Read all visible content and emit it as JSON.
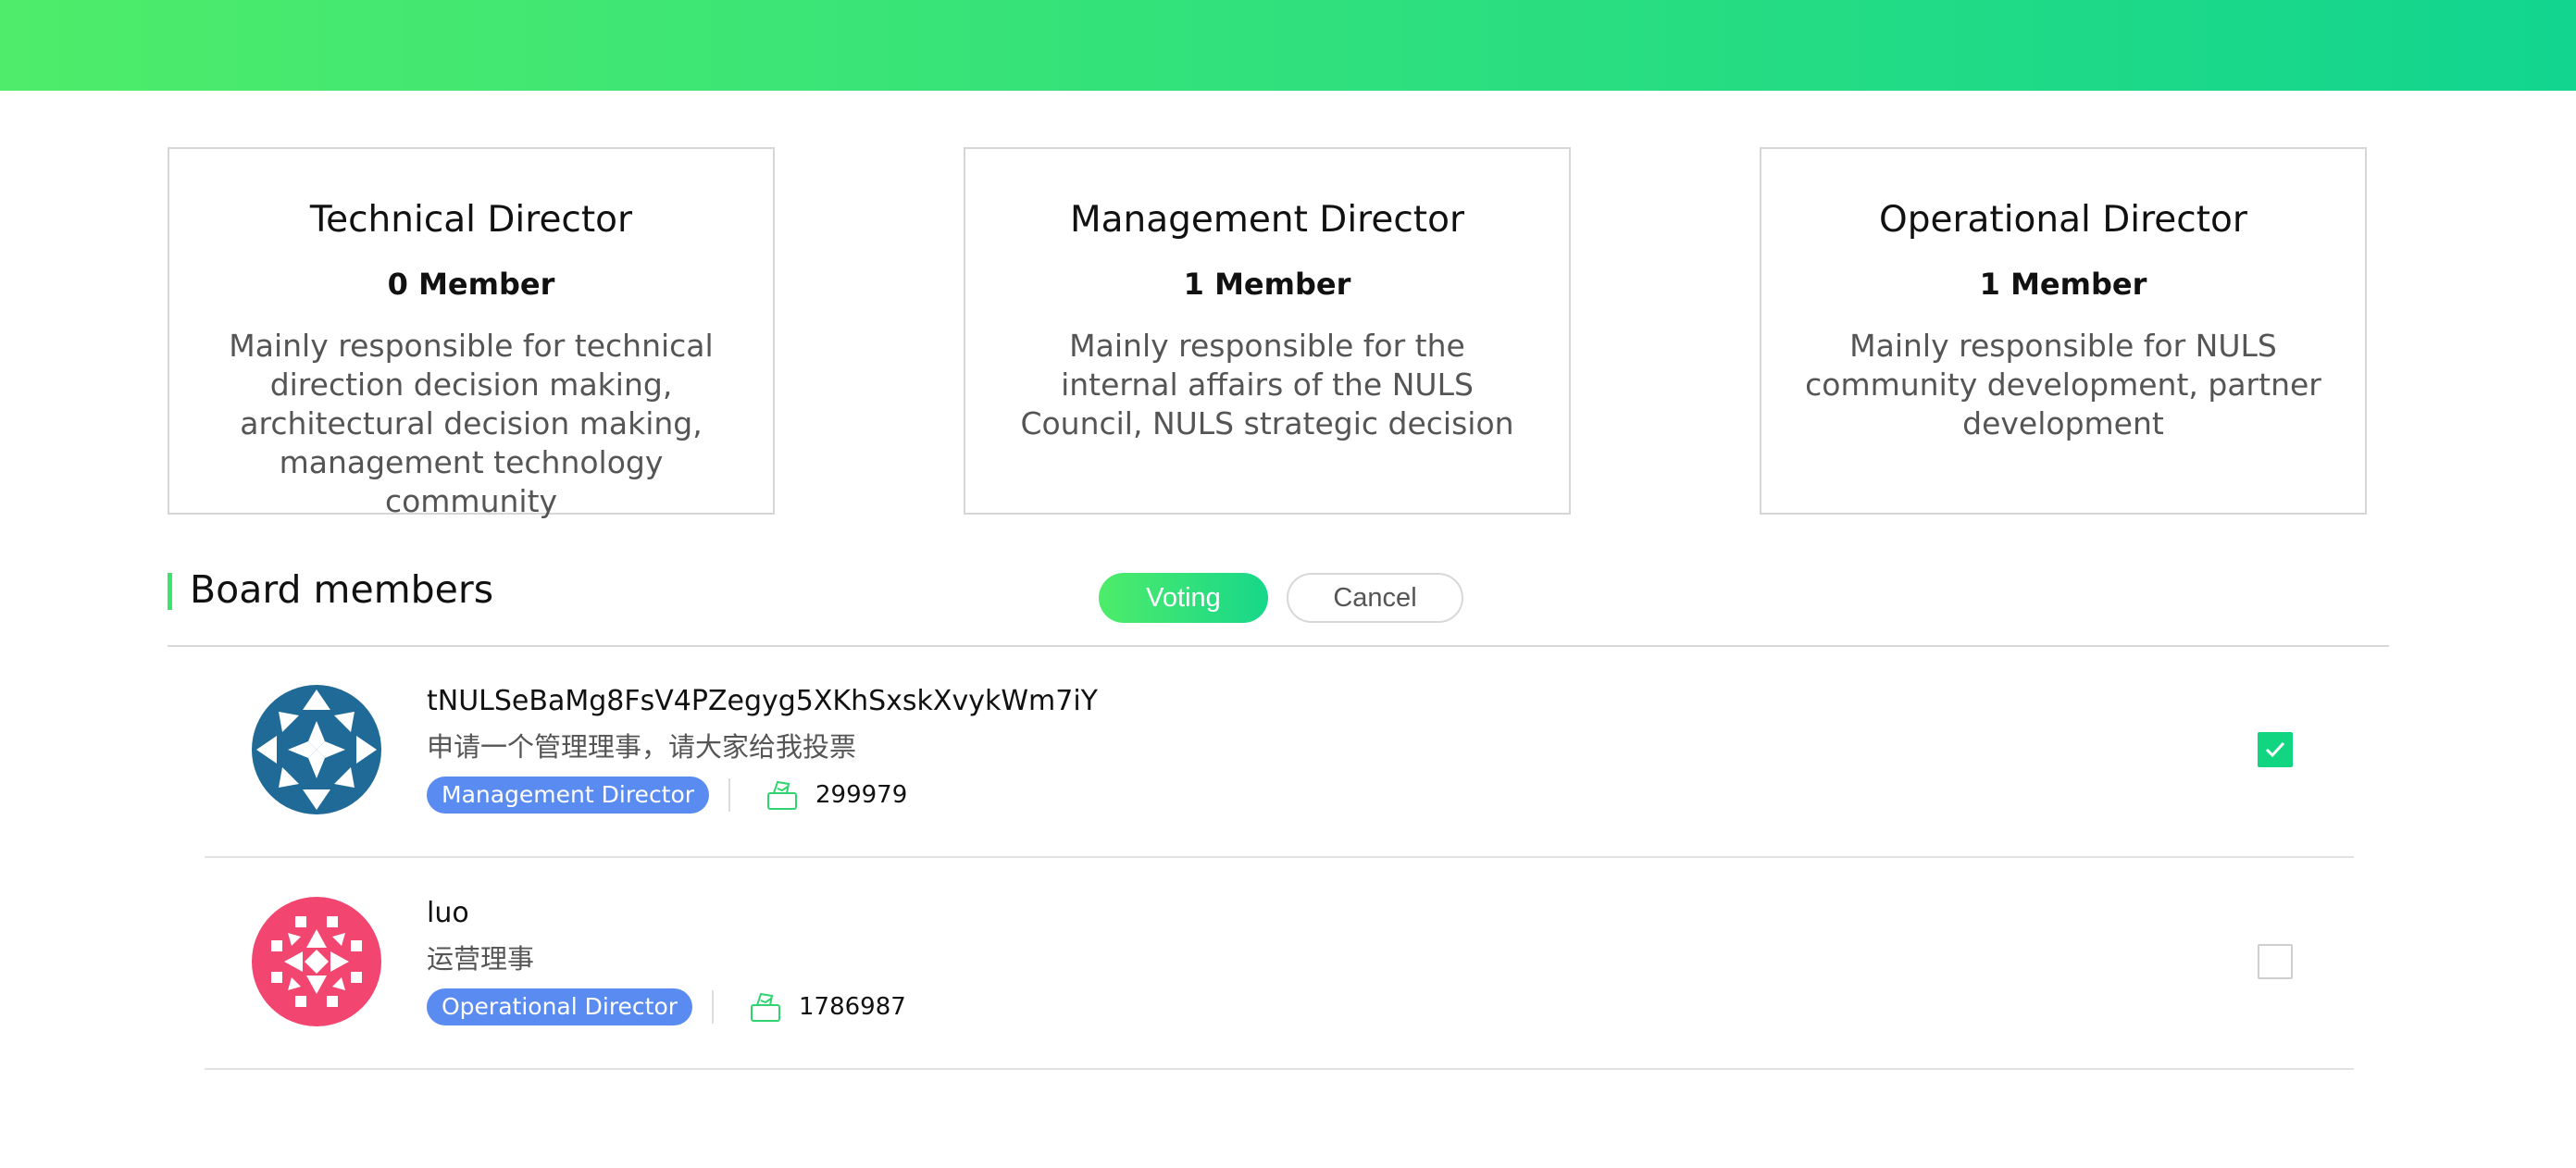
{
  "colors": {
    "accent_green": "#3ee26f",
    "banner_start": "#4eec6a",
    "banner_end": "#12d58f",
    "tag_blue": "#5a8bf0",
    "avatar1": "#1f6a97",
    "avatar2": "#f2456f",
    "checkbox_checked": "#12d581"
  },
  "roles": [
    {
      "title": "Technical Director",
      "count": "0 Member",
      "description": "Mainly responsible for technical direction decision making, architectural decision making, management technology community"
    },
    {
      "title": "Management Director",
      "count": "1 Member",
      "description": "Mainly responsible for the internal affairs of the NULS Council, NULS strategic decision"
    },
    {
      "title": "Operational Director",
      "count": "1 Member",
      "description": "Mainly responsible for NULS community development, partner development"
    }
  ],
  "section": {
    "title": "Board members",
    "voting_label": "Voting",
    "cancel_label": "Cancel"
  },
  "members": [
    {
      "name": "tNULSeBaMg8FsV4PZegyg5XKhSxskXvykWm7iY",
      "description": "申请一个管理理事，请大家给我投票",
      "role_tag": "Management Director",
      "votes": "299979",
      "avatar_icon": "identicon-avatar",
      "vote_icon": "ballot-box-icon",
      "checked": true
    },
    {
      "name": "luo",
      "description": "运营理事",
      "role_tag": "Operational Director",
      "votes": "1786987",
      "avatar_icon": "identicon-avatar",
      "vote_icon": "ballot-box-icon",
      "checked": false
    }
  ]
}
